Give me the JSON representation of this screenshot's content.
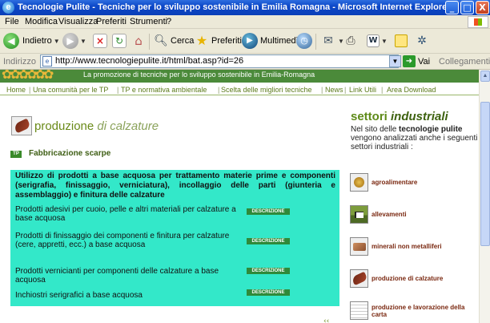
{
  "window": {
    "title": "Tecnologie Pulite - Tecniche per lo sviluppo sostenibile in Emilia Romagna - Microsoft Internet Explorer",
    "app_icon": "e",
    "controls": {
      "minimize": "_",
      "maximize": "□",
      "close": "X"
    }
  },
  "menu": [
    "File",
    "Modifica",
    "Visualizza",
    "Preferiti",
    "Strumenti",
    "?"
  ],
  "toolbar": {
    "back_label": "Indietro",
    "search_label": "Cerca",
    "favorites_label": "Preferiti",
    "media_label": "Multimedia",
    "icons": [
      "back-icon",
      "forward-icon",
      "stop-icon",
      "refresh-icon",
      "home-icon",
      "search-icon",
      "favorites-star-icon",
      "multimedia-icon",
      "history-icon",
      "mail-icon",
      "print-icon",
      "word-icon",
      "note-icon",
      "messenger-icon"
    ]
  },
  "address": {
    "label": "Indirizzo",
    "url": "http://www.tecnologiepulite.it/html/bat.asp?id=26",
    "go_label": "Vai",
    "links_label": "Collegamenti"
  },
  "banner": {
    "deco": "✿✿✿✿✿✿",
    "text": "La promozione di tecniche per lo sviluppo sostenibile in Emilia-Romagna"
  },
  "nav": [
    "Home",
    "Una comunità per le TP",
    "TP e normativa ambientale",
    "Scelta delle migliori tecniche",
    "News",
    "Link Utili",
    "Area Download"
  ],
  "left": {
    "title_main": "produzione",
    "title_italic": "di calzature",
    "tp_badge": "TP",
    "subtitle": "Fabbricazione scarpe",
    "panel_heading": "Utilizzo di prodotti a base acquosa per trattamento materie prime e componenti (serigrafia, finissaggio, verniciatura), incollaggio delle parti (giunteria e assemblaggio) e finitura delle calzature",
    "items": [
      {
        "text": "Prodotti adesivi per cuoio, pelle e altri materiali per calzature a base acquosa",
        "button": "DESCRIZIONE"
      },
      {
        "text": "Prodotti di finissaggio dei componenti e finitura per calzature (cere, appretti, ecc.) a base acquosa",
        "button": "DESCRIZIONE"
      },
      {
        "text": "Prodotti vernicianti per componenti delle calzature a base acquosa",
        "button": "DESCRIZIONE"
      },
      {
        "text": "Inchiostri serigrafici a base acquosa",
        "button": "DESCRIZIONE"
      }
    ]
  },
  "right": {
    "title_main": "settori",
    "title_italic": "industriali",
    "intro_pre": "Nel sito delle",
    "intro_bold": "tecnologie pulite",
    "intro_post": "vengono analizzati anche i seguenti settori industriali :",
    "sectors": [
      {
        "label": "agroalimentare",
        "icon": "agro-icon"
      },
      {
        "label": "allevamenti",
        "icon": "livestock-icon"
      },
      {
        "label": "minerali non metalliferi",
        "icon": "minerals-icon"
      },
      {
        "label": "produzione di calzature",
        "icon": "shoe-icon"
      },
      {
        "label": "produzione e lavorazione della carta",
        "icon": "paper-icon"
      }
    ]
  },
  "bottom_mark": "‹‹"
}
